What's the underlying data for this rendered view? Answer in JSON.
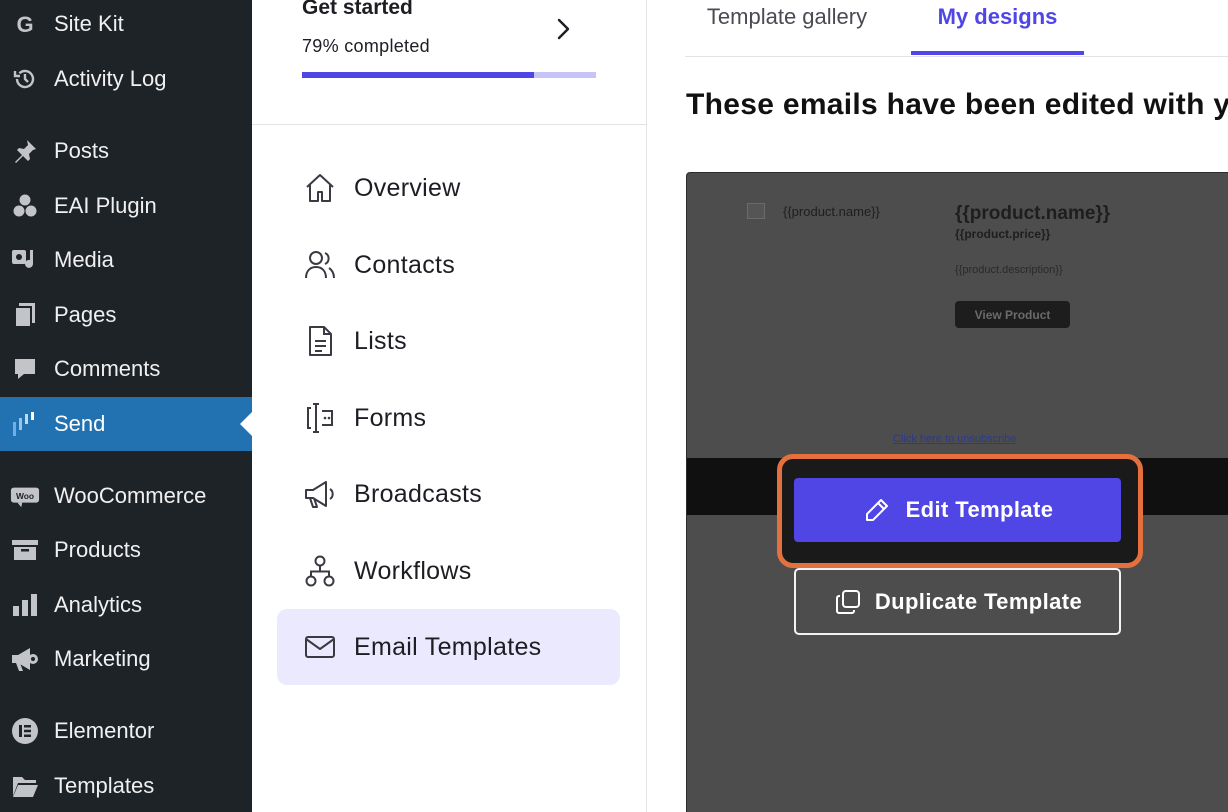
{
  "wp_menu": {
    "items": [
      {
        "label": "Site Kit",
        "icon": "site-kit-icon"
      },
      {
        "label": "Activity Log",
        "icon": "activity-log-icon"
      },
      {
        "label": "Posts",
        "icon": "pin-icon"
      },
      {
        "label": "EAI Plugin",
        "icon": "eai-plugin-icon"
      },
      {
        "label": "Media",
        "icon": "media-icon"
      },
      {
        "label": "Pages",
        "icon": "pages-icon"
      },
      {
        "label": "Comments",
        "icon": "comment-icon"
      },
      {
        "label": "Send",
        "icon": "send-icon",
        "active": true
      },
      {
        "label": "WooCommerce",
        "icon": "woocommerce-icon"
      },
      {
        "label": "Products",
        "icon": "archive-icon"
      },
      {
        "label": "Analytics",
        "icon": "bar-chart-icon"
      },
      {
        "label": "Marketing",
        "icon": "megaphone-icon"
      },
      {
        "label": "Elementor",
        "icon": "elementor-icon"
      },
      {
        "label": "Templates",
        "icon": "folder-icon"
      }
    ]
  },
  "get_started": {
    "title": "Get started",
    "progress_label": "79% completed",
    "progress": 0.79
  },
  "plugin_nav": {
    "items": [
      {
        "label": "Overview",
        "icon": "home-icon"
      },
      {
        "label": "Contacts",
        "icon": "contacts-icon"
      },
      {
        "label": "Lists",
        "icon": "document-icon"
      },
      {
        "label": "Forms",
        "icon": "form-icon"
      },
      {
        "label": "Broadcasts",
        "icon": "megaphone-icon"
      },
      {
        "label": "Workflows",
        "icon": "workflow-icon"
      },
      {
        "label": "Email Templates",
        "icon": "mail-icon",
        "active": true
      }
    ]
  },
  "tabs": [
    {
      "label": "Template gallery",
      "active": false
    },
    {
      "label": "My designs",
      "active": true
    }
  ],
  "heading": "These emails have been edited with yo",
  "preview": {
    "image_alt": "{{product.name}}",
    "product_name": "{{product.name}}",
    "product_price": "{{product.price}}",
    "product_description": "{{product.description}}",
    "view_button": "View Product",
    "unsubscribe": "Click here to unsubscribe"
  },
  "actions": {
    "edit": "Edit Template",
    "duplicate": "Duplicate Template"
  },
  "colors": {
    "wp_sidebar": "#1d2327",
    "wp_active": "#2271b1",
    "accent": "#5046e5",
    "highlight": "#e4713d"
  }
}
